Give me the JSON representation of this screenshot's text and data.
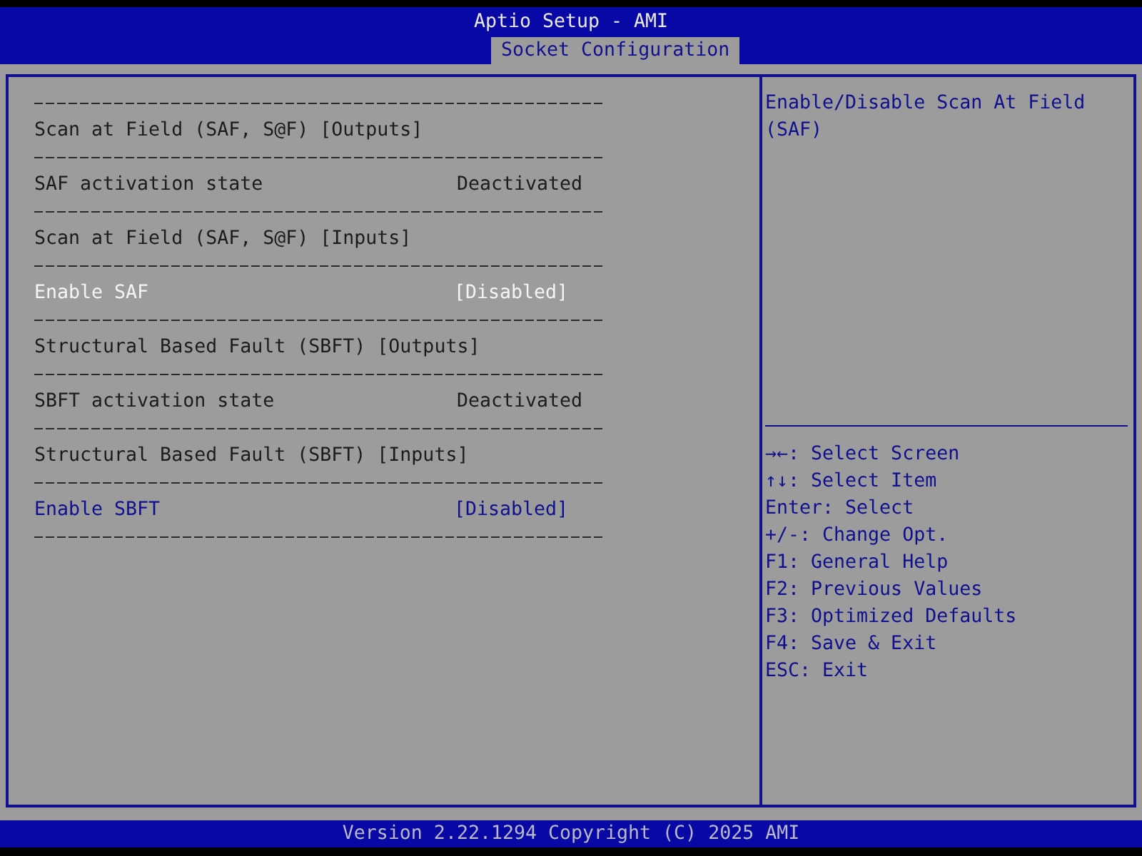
{
  "window": {
    "title": "Aptio Setup - AMI"
  },
  "tabs": [
    {
      "label": "Socket Configuration",
      "selected": true
    }
  ],
  "items": [
    {
      "kind": "separator"
    },
    {
      "kind": "subtitle",
      "label": "Scan at Field (SAF, S@F) [Outputs]"
    },
    {
      "kind": "separator"
    },
    {
      "kind": "info",
      "label": "SAF activation state",
      "value": "Deactivated"
    },
    {
      "kind": "separator"
    },
    {
      "kind": "subtitle",
      "label": "Scan at Field (SAF, S@F) [Inputs]"
    },
    {
      "kind": "separator"
    },
    {
      "kind": "option",
      "label": "Enable SAF",
      "value": "[Disabled]",
      "selected": true
    },
    {
      "kind": "separator"
    },
    {
      "kind": "subtitle",
      "label": "Structural Based Fault (SBFT) [Outputs]"
    },
    {
      "kind": "separator"
    },
    {
      "kind": "info",
      "label": "SBFT activation state",
      "value": "Deactivated"
    },
    {
      "kind": "separator"
    },
    {
      "kind": "subtitle",
      "label": "Structural Based Fault (SBFT) [Inputs]"
    },
    {
      "kind": "separator"
    },
    {
      "kind": "option",
      "label": "Enable SBFT",
      "value": "[Disabled]",
      "selected": false
    },
    {
      "kind": "separator"
    }
  ],
  "help": {
    "text": "Enable/Disable Scan At Field (SAF)"
  },
  "key_hints": [
    "→←: Select Screen",
    "↑↓: Select Item",
    "Enter: Select",
    "+/-: Change Opt.",
    "F1: General Help",
    "F2: Previous Values",
    "F3: Optimized Defaults",
    "F4: Save & Exit",
    "ESC: Exit"
  ],
  "status_bar": {
    "text": "Version 2.22.1294 Copyright (C) 2025 AMI"
  }
}
